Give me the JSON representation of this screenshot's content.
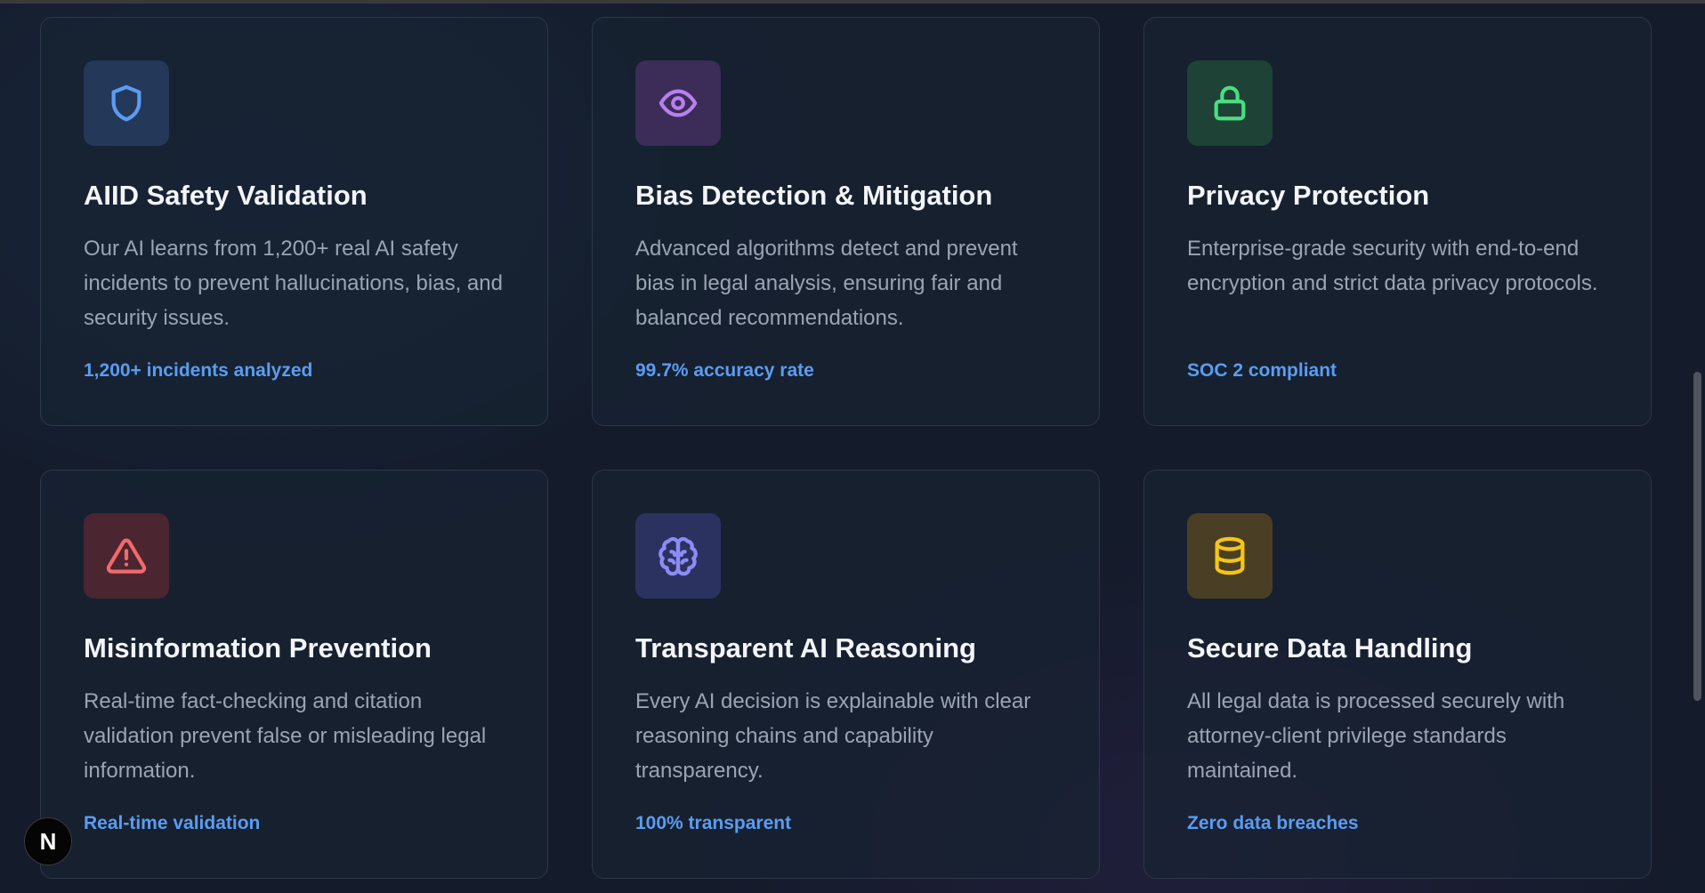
{
  "cards": [
    {
      "icon": "shield-icon",
      "icon_color": "#5b9cf0",
      "icon_bg": "#24385a",
      "title": "AIID Safety Validation",
      "description": "Our AI learns from 1,200+ real AI safety incidents to prevent hallucinations, bias, and security issues.",
      "stat": "1,200+ incidents analyzed"
    },
    {
      "icon": "eye-icon",
      "icon_color": "#b77ff0",
      "icon_bg": "#3b2c58",
      "title": "Bias Detection & Mitigation",
      "description": "Advanced algorithms detect and prevent bias in legal analysis, ensuring fair and balanced recommendations.",
      "stat": "99.7% accuracy rate"
    },
    {
      "icon": "lock-icon",
      "icon_color": "#4ade80",
      "icon_bg": "#1e4236",
      "title": "Privacy Protection",
      "description": "Enterprise-grade security with end-to-end encryption and strict data privacy protocols.",
      "stat": "SOC 2 compliant"
    },
    {
      "icon": "warning-triangle-icon",
      "icon_color": "#f06a6a",
      "icon_bg": "#4b2530",
      "title": "Misinformation Prevention",
      "description": "Real-time fact-checking and citation validation prevent false or misleading legal information.",
      "stat": "Real-time validation"
    },
    {
      "icon": "brain-icon",
      "icon_color": "#8b8cf6",
      "icon_bg": "#2c3260",
      "title": "Transparent AI Reasoning",
      "description": "Every AI decision is explainable with clear reasoning chains and capability transparency.",
      "stat": "100% transparent"
    },
    {
      "icon": "database-icon",
      "icon_color": "#f5c518",
      "icon_bg": "#4a3f25",
      "title": "Secure Data Handling",
      "description": "All legal data is processed securely with attorney-client privilege standards maintained.",
      "stat": "Zero data breaches"
    }
  ],
  "badge": {
    "letter": "N",
    "icon": "nextjs-logo-icon"
  },
  "colors": {
    "page_bg": "#141b2a",
    "card_border": "#2d3748",
    "accent_blue": "#5b9cf0"
  }
}
